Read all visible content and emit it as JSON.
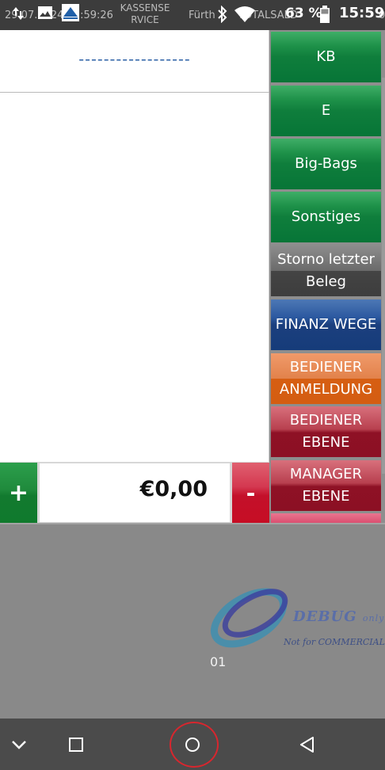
{
  "status_bar": {
    "background_date_text": "29.07.2024 15:59:26",
    "background_app_name_line1": "KASSENSE",
    "background_app_name_line2": "RVICE",
    "background_city": "Fürth",
    "background_total": "TOTALSALD",
    "background_end": "0",
    "battery_percent": "63 %",
    "clock": "15:59",
    "icons": [
      "upload-download-icon",
      "gallery-icon",
      "app-logo-icon",
      "bluetooth-icon",
      "wifi-icon",
      "battery-icon"
    ]
  },
  "receipt": {
    "header_text": "------------------"
  },
  "amount": {
    "plus_label": "+",
    "value": "€0,00",
    "minus_label": "-"
  },
  "right_buttons": [
    {
      "line1": "KB",
      "line2": "",
      "color": "#0f7e3c"
    },
    {
      "line1": "E",
      "line2": "",
      "color": "#0f7e3c"
    },
    {
      "line1": "Big-Bags",
      "line2": "",
      "color": "#0f7e3c"
    },
    {
      "line1": "Sonstiges",
      "line2": "",
      "color": "#0f7e3c"
    },
    {
      "line1": "Storno letzter",
      "line2": "Beleg",
      "color": "#444444"
    },
    {
      "line1": "FINANZ WEGE",
      "line2": "",
      "color": "#1b3f7e"
    },
    {
      "line1": "BEDIENER",
      "line2": "ANMELDUNG",
      "color": "#d65e12"
    },
    {
      "line1": "BEDIENER",
      "line2": "EBENE",
      "color": "#8e1125"
    },
    {
      "line1": "MANAGER",
      "line2": "EBENE",
      "color": "#8e1125"
    }
  ],
  "terminal_id": "01",
  "watermark": {
    "title": "DEBUG",
    "title_suffix": "only",
    "subtitle": "Not for COMMERCIAL"
  },
  "nav_bar": {
    "icons": [
      "chevron-down-icon",
      "recents-square-icon",
      "home-circle-icon",
      "back-triangle-icon"
    ]
  }
}
